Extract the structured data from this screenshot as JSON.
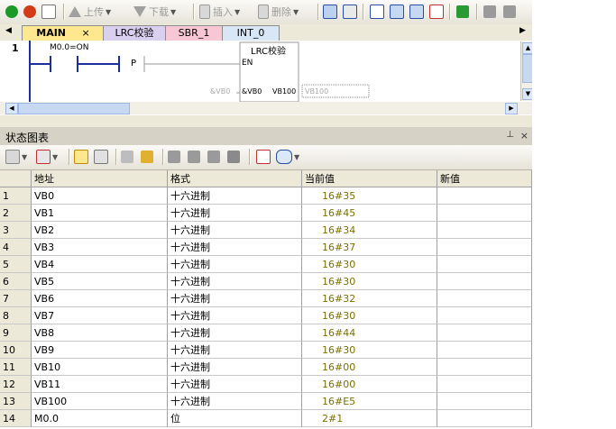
{
  "toolbar": {
    "upload_label": "上传",
    "download_label": "下载",
    "insert_label": "插入",
    "delete_label": "删除"
  },
  "tabs": [
    "MAIN",
    "LRC校验",
    "SBR_1",
    "INT_0"
  ],
  "ladder": {
    "rung_number": "1",
    "contact_label": "M0.0=ON",
    "edge_label": "P",
    "block_title": "LRC校验",
    "en_label": "EN",
    "param_value": "&VB0",
    "param_name": "&VB0",
    "vb100_label": "VB100",
    "vb100_value": "VB100"
  },
  "status_chart": {
    "title": "状态图表",
    "pin_icon": "pin-icon",
    "close_icon": "close-icon",
    "headers": [
      "",
      "地址",
      "格式",
      "当前值",
      "新值"
    ],
    "rows": [
      [
        "1",
        "VB0",
        "十六进制",
        "16#35",
        ""
      ],
      [
        "2",
        "VB1",
        "十六进制",
        "16#45",
        ""
      ],
      [
        "3",
        "VB2",
        "十六进制",
        "16#34",
        ""
      ],
      [
        "4",
        "VB3",
        "十六进制",
        "16#37",
        ""
      ],
      [
        "5",
        "VB4",
        "十六进制",
        "16#30",
        ""
      ],
      [
        "6",
        "VB5",
        "十六进制",
        "16#30",
        ""
      ],
      [
        "7",
        "VB6",
        "十六进制",
        "16#32",
        ""
      ],
      [
        "8",
        "VB7",
        "十六进制",
        "16#30",
        ""
      ],
      [
        "9",
        "VB8",
        "十六进制",
        "16#44",
        ""
      ],
      [
        "10",
        "VB9",
        "十六进制",
        "16#30",
        ""
      ],
      [
        "11",
        "VB10",
        "十六进制",
        "16#00",
        ""
      ],
      [
        "12",
        "VB11",
        "十六进制",
        "16#00",
        ""
      ],
      [
        "13",
        "VB100",
        "十六进制",
        "16#E5",
        ""
      ],
      [
        "14",
        "M0.0",
        "位",
        "2#1",
        ""
      ]
    ]
  },
  "colors": {
    "tab_main": "#fde890",
    "tab_lrc": "#d9d0f0",
    "tab_sbr": "#f7c7d6",
    "tab_int": "#d8e6f6",
    "value_text": "#7a7000",
    "ladder_blue": "#1a2e9c"
  }
}
